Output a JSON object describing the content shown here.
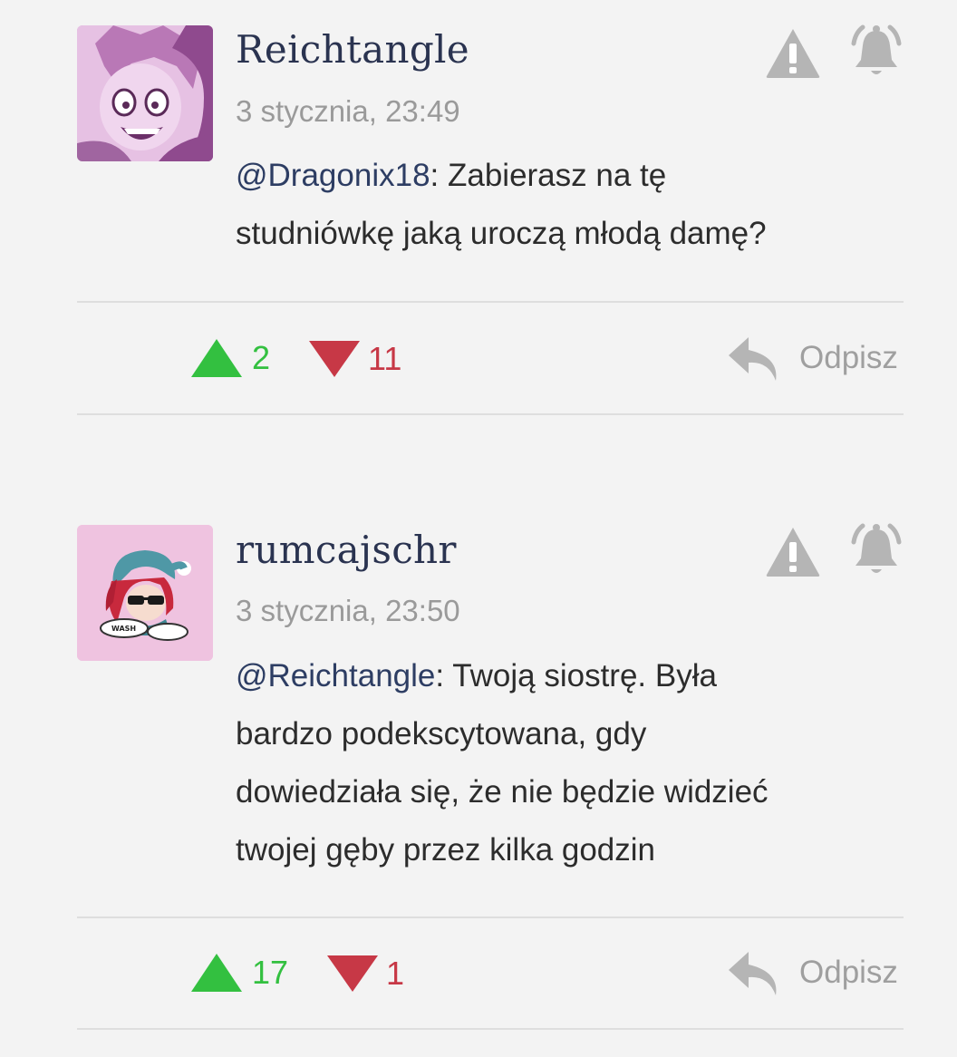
{
  "comments": [
    {
      "author": "Reichtangle",
      "timestamp": "3 stycznia, 23:49",
      "mention": "@Dragonix18",
      "text_line1": ": Zabierasz na tę",
      "text_line2": "studniówkę jaką uroczą młodą damę?",
      "upvotes": "2",
      "downvotes": "11",
      "reply_label": "Odpisz",
      "avatar_bg": "#d9a9d6"
    },
    {
      "author": "rumcajschr",
      "timestamp": "3 stycznia, 23:50",
      "mention": "@Reichtangle",
      "text_line1": ": Twoją siostrę. Była",
      "text_line2": "bardzo podekscytowana, gdy",
      "text_line3": "dowiedziała się, że nie będzie widzieć",
      "text_line4": "twojej gęby przez kilka godzin",
      "upvotes": "17",
      "downvotes": "1",
      "reply_label": "Odpisz",
      "avatar_bg": "#efc3e0",
      "avatar_tag": "WASH"
    }
  ],
  "colors": {
    "upvote": "#33c040",
    "downvote": "#c73846",
    "icon_gray": "#b5b5b5",
    "author": "#2a3350"
  }
}
